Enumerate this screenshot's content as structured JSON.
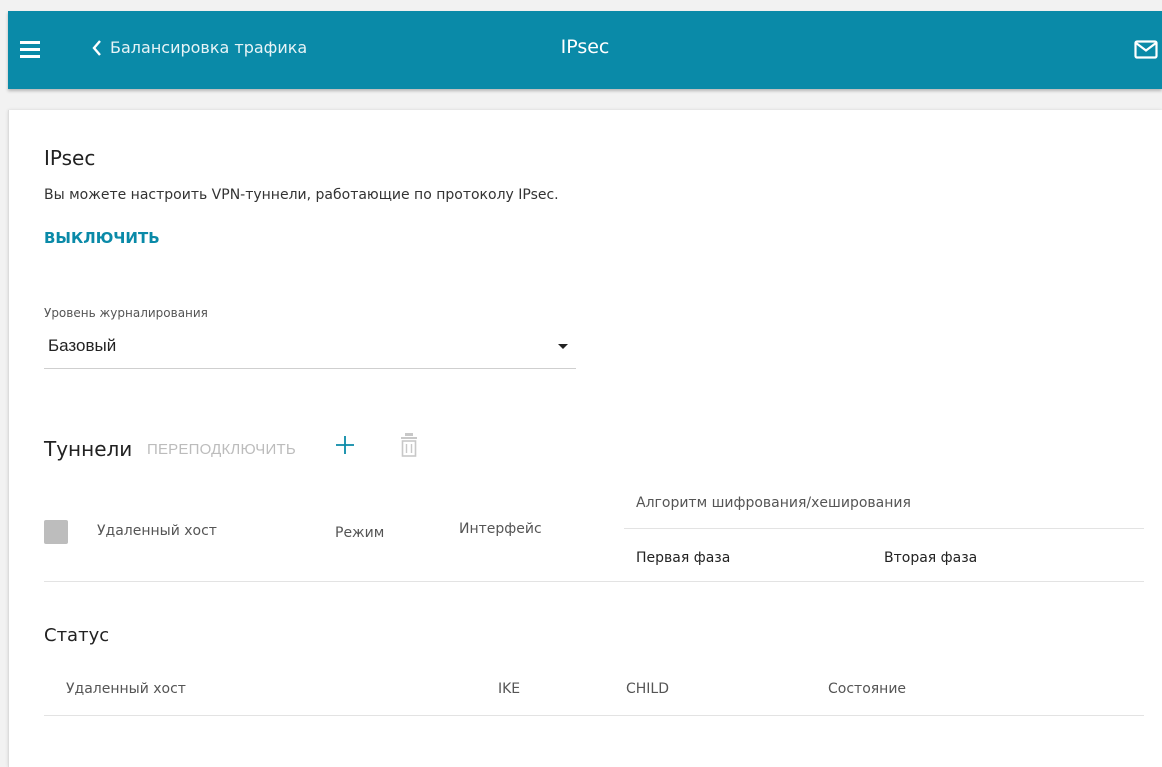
{
  "header": {
    "back_label": "Балансировка трафика",
    "title": "IPsec",
    "menu_icon": "hamburger-icon",
    "back_icon": "chevron-left-icon",
    "mail_icon": "mail-icon"
  },
  "main": {
    "title": "IPsec",
    "description": "Вы можете настроить VPN-туннели, работающие по протоколу IPsec.",
    "toggle_link": "ВЫКЛЮЧИТЬ",
    "log_level": {
      "label": "Уровень журналирования",
      "value": "Базовый"
    }
  },
  "tunnels": {
    "title": "Туннели",
    "reconnect_label": "ПЕРЕПОДКЛЮЧИТЬ",
    "columns": {
      "remote_host": "Удаленный хост",
      "mode": "Режим",
      "interface": "Интерфейс",
      "algorithm": "Алгоритм шифрования/хеширования",
      "phase1": "Первая фаза",
      "phase2": "Вторая фаза"
    }
  },
  "status": {
    "title": "Статус",
    "columns": [
      "Удаленный хост",
      "IKE",
      "CHILD",
      "Состояние"
    ]
  },
  "colors": {
    "accent": "#0a8aa8",
    "disabled": "#bcbcbc"
  }
}
